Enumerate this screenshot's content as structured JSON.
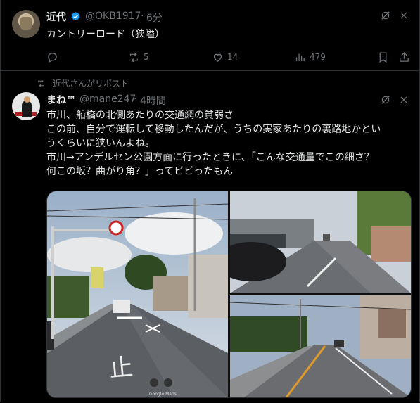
{
  "post1": {
    "name": "近代",
    "handle": "@OKB1917",
    "dot": "·",
    "time": "6分",
    "text": "カントリーロード（狭隘）",
    "actions": {
      "reply": "",
      "repost": "5",
      "like": "14",
      "views": "479"
    }
  },
  "repost_banner": "近代さんがリポスト",
  "post2": {
    "name": "まね™",
    "handle": "@mane247",
    "dot": "·",
    "time": "4時間",
    "lines": [
      "市川、船橋の北側あたりの交通網の貧弱さ",
      "この前、自分で運転して移動したんだが、うちの実家あたりの裏路地かとい",
      "うくらいに狭いんよね。",
      "市川→アンデルセン公園方面に行ったときに、「こんな交通量でこの細さ？",
      "何この坂？曲がり角？」ってビビったもん"
    ],
    "image_caption": "Google Maps"
  },
  "colors": {
    "background": "#000000",
    "text": "#e7e9ea",
    "muted": "#71767b",
    "verified": "#1d9bf0",
    "border": "#2f3336"
  },
  "icons": [
    "grok-icon",
    "more-icon",
    "reply-icon",
    "repost-icon",
    "like-icon",
    "views-icon",
    "bookmark-icon",
    "share-icon",
    "verified-badge-icon"
  ]
}
